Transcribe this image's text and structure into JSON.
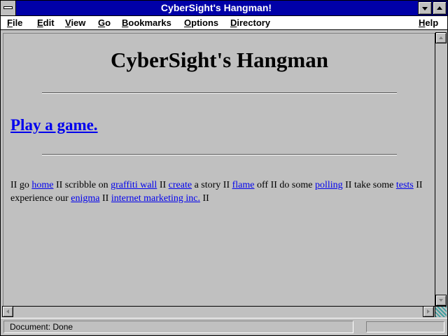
{
  "window": {
    "title": "CyberSight's Hangman!"
  },
  "menubar": {
    "items": [
      {
        "key": "F",
        "rest": "ile"
      },
      {
        "key": "E",
        "rest": "dit"
      },
      {
        "key": "V",
        "rest": "iew"
      },
      {
        "key": "G",
        "rest": "o"
      },
      {
        "key": "B",
        "rest": "ookmarks"
      },
      {
        "key": "O",
        "rest": "ptions"
      },
      {
        "key": "D",
        "rest": "irectory"
      },
      {
        "key": "H",
        "rest": "elp"
      }
    ]
  },
  "page": {
    "heading": "CyberSight's Hangman",
    "play_link": "Play a game.",
    "nav": {
      "sep": "II",
      "t_go": "go",
      "l_home": "home",
      "t_scribble": "scribble on",
      "l_graffiti": "graffiti wall",
      "l_create": "create",
      "t_story": "a story",
      "l_flame": "flame",
      "t_off": "off",
      "t_polling_pre": "do some",
      "l_polling": "polling",
      "t_tests_pre": "take some",
      "l_tests": "tests",
      "t_experience": "experience our",
      "l_enigma": "enigma",
      "l_imi": "internet marketing inc."
    }
  },
  "status": {
    "text": "Document: Done"
  },
  "colors": {
    "titlebar": "#0000a8",
    "link": "#0000ee",
    "chrome": "#c0c0c0"
  }
}
